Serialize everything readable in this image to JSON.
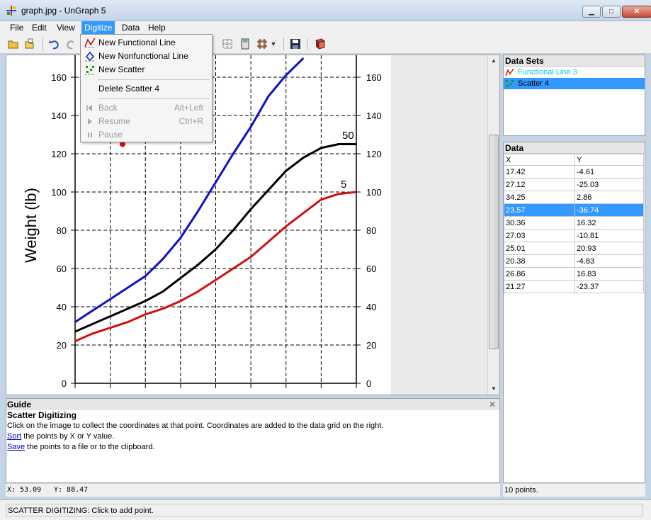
{
  "window": {
    "title": "graph.jpg - UnGraph 5",
    "minimize": "▁",
    "maximize": "□",
    "close": "✕"
  },
  "menubar": [
    {
      "label": "File"
    },
    {
      "label": "Edit"
    },
    {
      "label": "View"
    },
    {
      "label": "Digitize"
    },
    {
      "label": "Data"
    },
    {
      "label": "Help"
    }
  ],
  "digitize_menu": {
    "new_functional_line": "New Functional Line",
    "new_nonfunctional_line": "New Nonfunctional Line",
    "new_scatter": "New Scatter",
    "delete_scatter": "Delete Scatter 4",
    "back": "Back",
    "back_key": "Alt+Left",
    "resume": "Resume",
    "resume_key": "Ctrl+R",
    "pause": "Pause"
  },
  "toolbar": {
    "icons": [
      "open-folder-icon",
      "open-icon",
      "undo-icon",
      "redo-icon",
      "grid-icon",
      "color-icon",
      "calculator-icon",
      "grid-options-icon",
      "save-icon",
      "book-icon"
    ]
  },
  "chart_data": {
    "type": "line",
    "ylabel": "Weight (lb)",
    "ylim": [
      0,
      170
    ],
    "y_ticks": [
      "0",
      "20",
      "40",
      "60",
      "80",
      "100",
      "120",
      "140",
      "160"
    ],
    "grid": true,
    "annotations": [
      "50",
      "5"
    ],
    "series": [
      {
        "name": "",
        "color": "#1010c8",
        "points": [
          [
            0,
            32
          ],
          [
            1,
            38
          ],
          [
            2,
            44
          ],
          [
            3,
            50
          ],
          [
            4,
            56
          ],
          [
            5,
            65
          ],
          [
            6,
            76
          ],
          [
            7,
            90
          ],
          [
            8,
            105
          ],
          [
            9,
            120
          ],
          [
            10,
            134
          ],
          [
            11,
            150
          ],
          [
            12,
            161
          ],
          [
            13,
            170
          ]
        ]
      },
      {
        "name": "",
        "color": "#000000",
        "points": [
          [
            0,
            27
          ],
          [
            1,
            31
          ],
          [
            2,
            35
          ],
          [
            3,
            39
          ],
          [
            4,
            43
          ],
          [
            5,
            48
          ],
          [
            6,
            55
          ],
          [
            7,
            62
          ],
          [
            8,
            70
          ],
          [
            9,
            80
          ],
          [
            10,
            91
          ],
          [
            11,
            101
          ],
          [
            12,
            111
          ],
          [
            13,
            118
          ],
          [
            14,
            123
          ],
          [
            15,
            125
          ],
          [
            16,
            125
          ]
        ]
      },
      {
        "name": "",
        "color": "#d01010",
        "points": [
          [
            0,
            22
          ],
          [
            1,
            26
          ],
          [
            2,
            29
          ],
          [
            3,
            32
          ],
          [
            4,
            36
          ],
          [
            5,
            39
          ],
          [
            6,
            43
          ],
          [
            7,
            48
          ],
          [
            8,
            54
          ],
          [
            9,
            60
          ],
          [
            10,
            66
          ],
          [
            11,
            74
          ],
          [
            12,
            82
          ],
          [
            13,
            89
          ],
          [
            14,
            96
          ],
          [
            15,
            99
          ],
          [
            16,
            100
          ]
        ]
      }
    ],
    "red_point": [
      2.7,
      125
    ]
  },
  "datasets": {
    "header": "Data Sets",
    "items": [
      {
        "label": "Functional Line 3",
        "selected": false
      },
      {
        "label": "Scatter 4",
        "selected": true
      }
    ]
  },
  "data": {
    "header": "Data",
    "col_x": "X",
    "col_y": "Y",
    "rows": [
      {
        "x": "17.42",
        "y": "-4.61"
      },
      {
        "x": "27.12",
        "y": "-25.03"
      },
      {
        "x": "34.25",
        "y": "2.86"
      },
      {
        "x": "23.57",
        "y": "-36.74"
      },
      {
        "x": "30.36",
        "y": "16.32"
      },
      {
        "x": "27.03",
        "y": "-10.81"
      },
      {
        "x": "25.01",
        "y": "20.93"
      },
      {
        "x": "20.38",
        "y": "-4.83"
      },
      {
        "x": "26.86",
        "y": "16.83"
      },
      {
        "x": "21.27",
        "y": "-23.37"
      }
    ],
    "selected_row": 3
  },
  "guide": {
    "header": "Guide",
    "close": "✕",
    "title": "Scatter Digitizing",
    "line1": "Click on the image to collect the coordinates at that point. Coordinates are added to the data grid on the right.",
    "sort_link": "Sort",
    "line2": " the points by X or Y value.",
    "save_link": "Save",
    "line3": " the points to a file or to the clipboard."
  },
  "coords": {
    "x_label": "X: 53.09",
    "y_label": "Y: 88.47"
  },
  "count": "10 points.",
  "status": "SCATTER DIGITIZING: Click to add point."
}
